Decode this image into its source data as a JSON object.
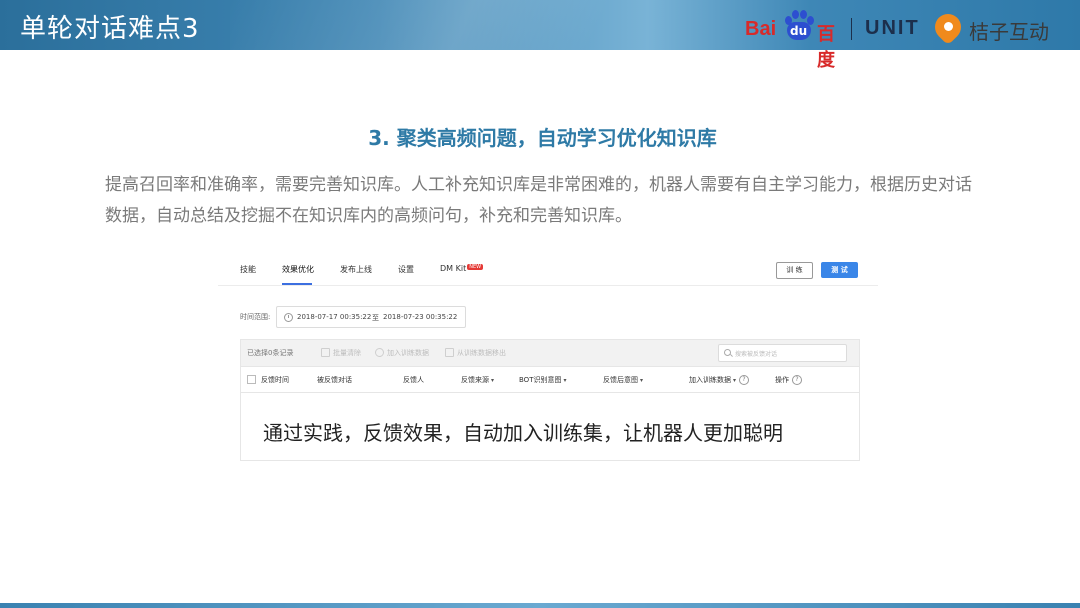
{
  "slide": {
    "title": "单轮对话难点3",
    "subtitle": "3. 聚类高频问题，自动学习优化知识库",
    "paragraph": "提高召回率和准确率，需要完善知识库。人工补充知识库是非常困难的，机器人需要有自主学习能力，根据历史对话数据，自动总结及挖掘不在知识库内的高频问句，补充和完善知识库。"
  },
  "logos": {
    "baidu_latin": "Bai",
    "baidu_du": "du",
    "baidu_cn": "百度",
    "unit": "UNIT",
    "juzi": "桔子互动"
  },
  "screenshot": {
    "tabs": [
      {
        "label": "技能"
      },
      {
        "label": "效果优化",
        "active": true
      },
      {
        "label": "发布上线"
      },
      {
        "label": "设置"
      },
      {
        "label": "DM Kit",
        "badge": "NEW"
      }
    ],
    "buttons": {
      "train": "训 练",
      "test": "测 试"
    },
    "time_range": {
      "label": "时间范围:",
      "start": "2018-07-17 00:35:22",
      "to": "至",
      "end": "2018-07-23 00:35:22"
    },
    "toolbar": {
      "selected": "已选择0条记录",
      "batch_clear": "批量清除",
      "add_training": "加入训练数据",
      "remove_training": "从训练数据移出",
      "search_placeholder": "搜索被反馈对话"
    },
    "columns": [
      "反馈时间",
      "被反馈对话",
      "反馈人",
      "反馈来源",
      "BOT识别意图",
      "反馈后意图",
      "加入训练数据",
      "操作"
    ],
    "overlay_text": "通过实践，反馈效果，自动加入训练集，让机器人更加聪明"
  },
  "colors": {
    "header_blue": "#3f86b4",
    "subtitle_blue": "#2e7aa6",
    "baidu_red": "#d82a2a",
    "baidu_blue": "#2d4fd0",
    "juzi_orange": "#f08a1c",
    "test_button": "#3a86e8"
  }
}
